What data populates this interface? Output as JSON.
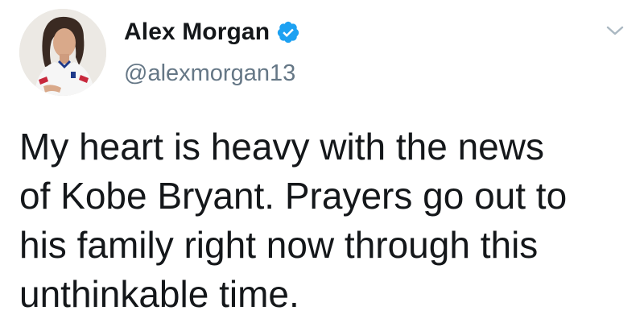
{
  "tweet": {
    "author": {
      "display_name": "Alex Morgan",
      "handle": "@alexmorgan13",
      "verified": true
    },
    "text": "My heart is heavy with the news\nof Kobe Bryant. Prayers go out to\nhis family right now through this\nunthinkable time."
  },
  "icons": {
    "verified": "verified-badge-icon",
    "menu": "chevron-down-icon",
    "avatar": "profile-photo"
  },
  "colors": {
    "verified_blue": "#1da1f2",
    "handle_gray": "#657786",
    "text_dark": "#14171a",
    "chevron_gray": "#aab8c2"
  }
}
